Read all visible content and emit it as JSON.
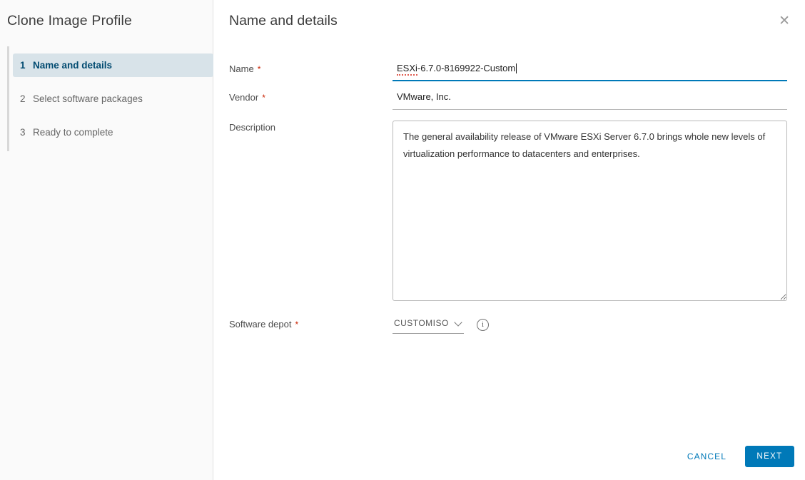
{
  "sidebar": {
    "title": "Clone Image Profile",
    "steps": [
      {
        "number": "1",
        "label": "Name and details",
        "active": true
      },
      {
        "number": "2",
        "label": "Select software packages",
        "active": false
      },
      {
        "number": "3",
        "label": "Ready to complete",
        "active": false
      }
    ]
  },
  "header": {
    "title": "Name and details",
    "close_icon": "✕"
  },
  "form": {
    "name": {
      "label": "Name",
      "required_mark": "*",
      "value": "ESXi-6.7.0-8169922-Custom"
    },
    "vendor": {
      "label": "Vendor",
      "required_mark": "*",
      "value": "VMware, Inc."
    },
    "description": {
      "label": "Description",
      "value": "The general availability release of VMware ESXi Server 6.7.0 brings whole new levels of virtualization performance to datacenters and enterprises."
    },
    "software_depot": {
      "label": "Software depot",
      "required_mark": "*",
      "value": "CUSTOMISO",
      "info_glyph": "i"
    }
  },
  "footer": {
    "cancel_label": "CANCEL",
    "next_label": "NEXT"
  },
  "colors": {
    "accent_blue": "#0079b8",
    "active_step_bg": "#d8e3e9",
    "active_step_text": "#004a70",
    "required_red": "#c92100",
    "sidebar_bg": "#fafafa"
  }
}
